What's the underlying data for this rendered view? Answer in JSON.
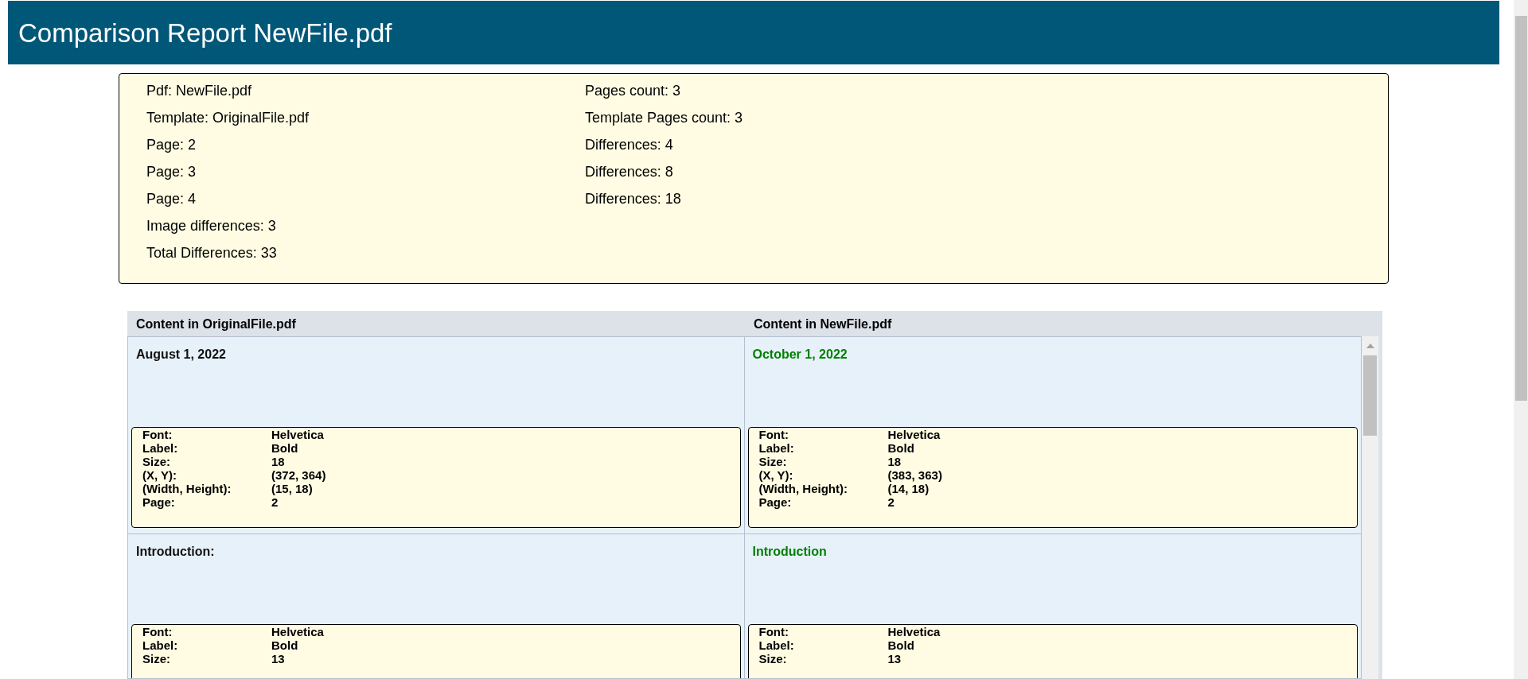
{
  "header": {
    "title": "Comparison Report NewFile.pdf"
  },
  "summary": {
    "left": [
      "Pdf: NewFile.pdf",
      "Template: OriginalFile.pdf",
      "Page: 2",
      "Page: 3",
      "Page: 4",
      "Image differences: 3",
      "Total Differences: 33"
    ],
    "right": [
      "Pages count: 3",
      "Template Pages count: 3",
      "Differences: 4",
      "Differences: 8",
      "Differences: 18"
    ]
  },
  "table": {
    "columns": [
      "Content in OriginalFile.pdf",
      "Content in NewFile.pdf"
    ],
    "rows": [
      {
        "cells": [
          {
            "text": "August 1, 2022",
            "changed": false,
            "properties": [
              [
                "Font:",
                "Helvetica"
              ],
              [
                "Label:",
                "Bold"
              ],
              [
                "Size:",
                "18"
              ],
              [
                "(X, Y):",
                "(372, 364)"
              ],
              [
                "(Width, Height):",
                "(15, 18)"
              ],
              [
                "Page:",
                "2"
              ]
            ]
          },
          {
            "text": "October 1, 2022",
            "changed": true,
            "properties": [
              [
                "Font:",
                "Helvetica"
              ],
              [
                "Label:",
                "Bold"
              ],
              [
                "Size:",
                "18"
              ],
              [
                "(X, Y):",
                "(383, 363)"
              ],
              [
                "(Width, Height):",
                "(14, 18)"
              ],
              [
                "Page:",
                "2"
              ]
            ]
          }
        ]
      },
      {
        "cells": [
          {
            "text": "Introduction:",
            "changed": false,
            "properties": [
              [
                "Font:",
                "Helvetica"
              ],
              [
                "Label:",
                "Bold"
              ],
              [
                "Size:",
                "13"
              ]
            ]
          },
          {
            "text": "Introduction",
            "changed": true,
            "properties": [
              [
                "Font:",
                "Helvetica"
              ],
              [
                "Label:",
                "Bold"
              ],
              [
                "Size:",
                "13"
              ]
            ]
          }
        ]
      }
    ]
  }
}
